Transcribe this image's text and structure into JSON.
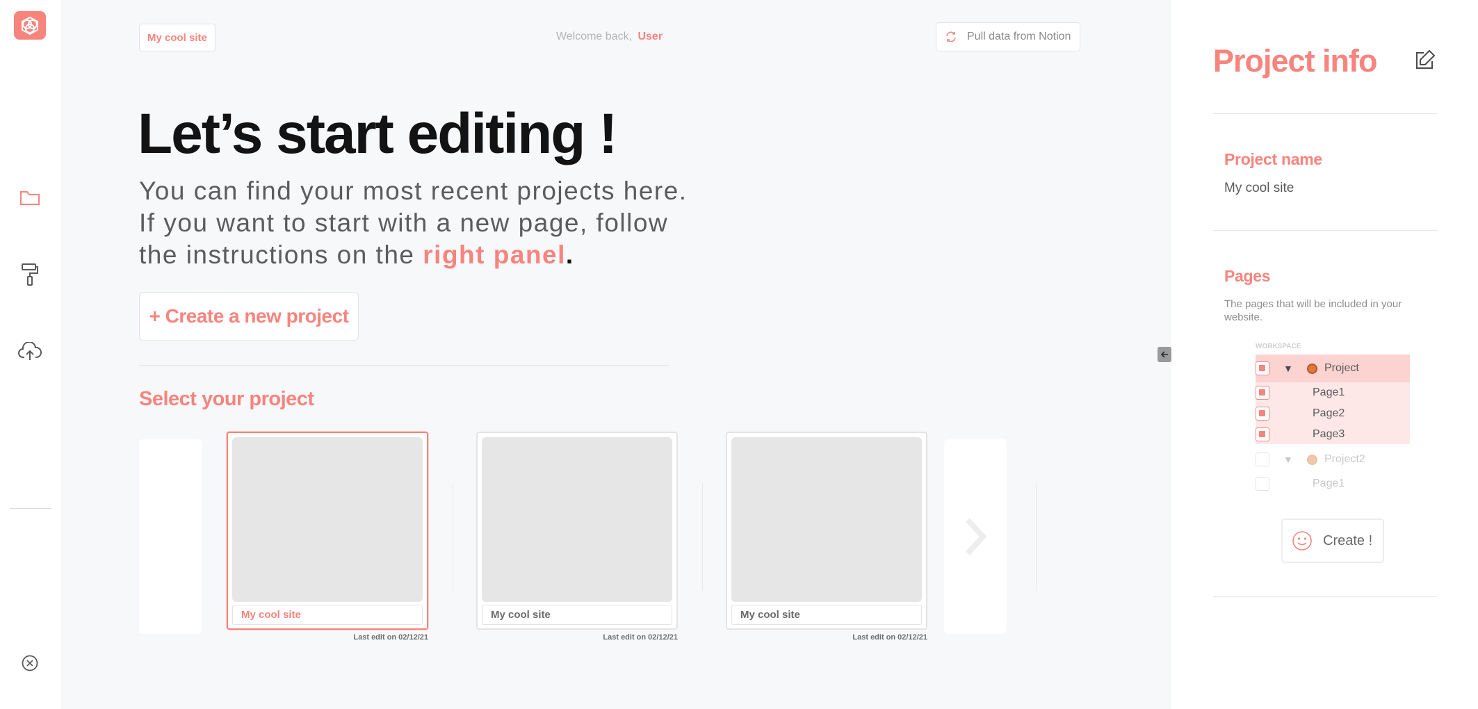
{
  "header": {
    "site_chip": "My cool site",
    "welcome_text": "Welcome back,",
    "user_name": "User",
    "pull_button": "Pull data from Notion"
  },
  "hero": {
    "title": "Let’s start editing !",
    "line1": "You can find your most recent projects here.",
    "line2": "If you want to start with a new page, follow",
    "line3_prefix": "the instructions on the ",
    "line3_highlight": "right panel",
    "line3_suffix": "."
  },
  "create_project_label": "+ Create a new project",
  "projects": {
    "section_title": "Select your project",
    "cards": [
      {
        "name": "My cool site",
        "last_edit": "Last edit on 02/12/21",
        "selected": true
      },
      {
        "name": "My cool site",
        "last_edit": "Last edit on 02/12/21",
        "selected": false
      },
      {
        "name": "My cool site",
        "last_edit": "Last edit on 02/12/21",
        "selected": false
      }
    ]
  },
  "sidebar": {
    "icons": [
      "logo-icon",
      "folder-icon",
      "paint-roller-icon",
      "cloud-upload-icon",
      "close-circle-icon"
    ]
  },
  "panel": {
    "title": "Project info",
    "project_name_title": "Project name",
    "project_name_value": "My cool site",
    "pages_title": "Pages",
    "pages_description": "The pages that will be included in your website.",
    "workspace_label": "WORKSPACE",
    "tree": [
      {
        "label": "Project",
        "type": "project",
        "checked": true
      },
      {
        "label": "Page1",
        "type": "page",
        "checked": true
      },
      {
        "label": "Page2",
        "type": "page",
        "checked": true
      },
      {
        "label": "Page3",
        "type": "page",
        "checked": true
      },
      {
        "label": "Project2",
        "type": "project",
        "checked": false
      },
      {
        "label": "Page1",
        "type": "page",
        "checked": false
      }
    ],
    "create_button": "Create !"
  },
  "colors": {
    "accent": "#f7847d",
    "background": "#f7f8fa",
    "title": "#131313"
  }
}
